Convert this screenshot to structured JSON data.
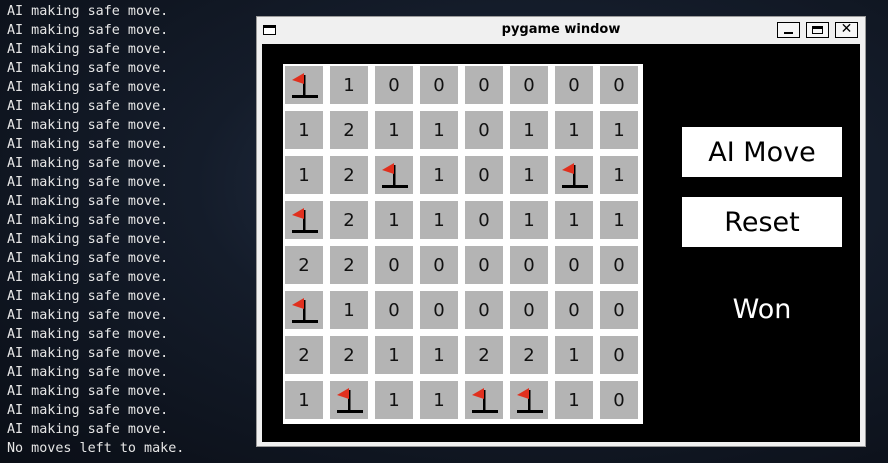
{
  "terminal": {
    "lines": [
      "AI making safe move.",
      "AI making safe move.",
      "AI making safe move.",
      "AI making safe move.",
      "AI making safe move.",
      "AI making safe move.",
      "AI making safe move.",
      "AI making safe move.",
      "AI making safe move.",
      "AI making safe move.",
      "AI making safe move.",
      "AI making safe move.",
      "AI making safe move.",
      "AI making safe move.",
      "AI making safe move.",
      "AI making safe move.",
      "AI making safe move.",
      "AI making safe move.",
      "AI making safe move.",
      "AI making safe move.",
      "AI making safe move.",
      "AI making safe move.",
      "AI making safe move.",
      "No moves left to make."
    ]
  },
  "window": {
    "title": "pygame window",
    "close_glyph": "✕"
  },
  "board": {
    "rows": [
      [
        "F",
        "1",
        "0",
        "0",
        "0",
        "0",
        "0",
        "0"
      ],
      [
        "1",
        "2",
        "1",
        "1",
        "0",
        "1",
        "1",
        "1"
      ],
      [
        "1",
        "2",
        "F",
        "1",
        "0",
        "1",
        "F",
        "1"
      ],
      [
        "F",
        "2",
        "1",
        "1",
        "0",
        "1",
        "1",
        "1"
      ],
      [
        "2",
        "2",
        "0",
        "0",
        "0",
        "0",
        "0",
        "0"
      ],
      [
        "F",
        "1",
        "0",
        "0",
        "0",
        "0",
        "0",
        "0"
      ],
      [
        "2",
        "2",
        "1",
        "1",
        "2",
        "2",
        "1",
        "0"
      ],
      [
        "1",
        "F",
        "1",
        "1",
        "F",
        "F",
        "1",
        "0"
      ]
    ],
    "flag_icon": "red-flag-icon",
    "colors": {
      "cell": "#b4b4b4",
      "grid": "#ffffff",
      "flag": "#e0301e"
    }
  },
  "controls": {
    "ai_move_label": "AI Move",
    "reset_label": "Reset",
    "status": "Won"
  }
}
